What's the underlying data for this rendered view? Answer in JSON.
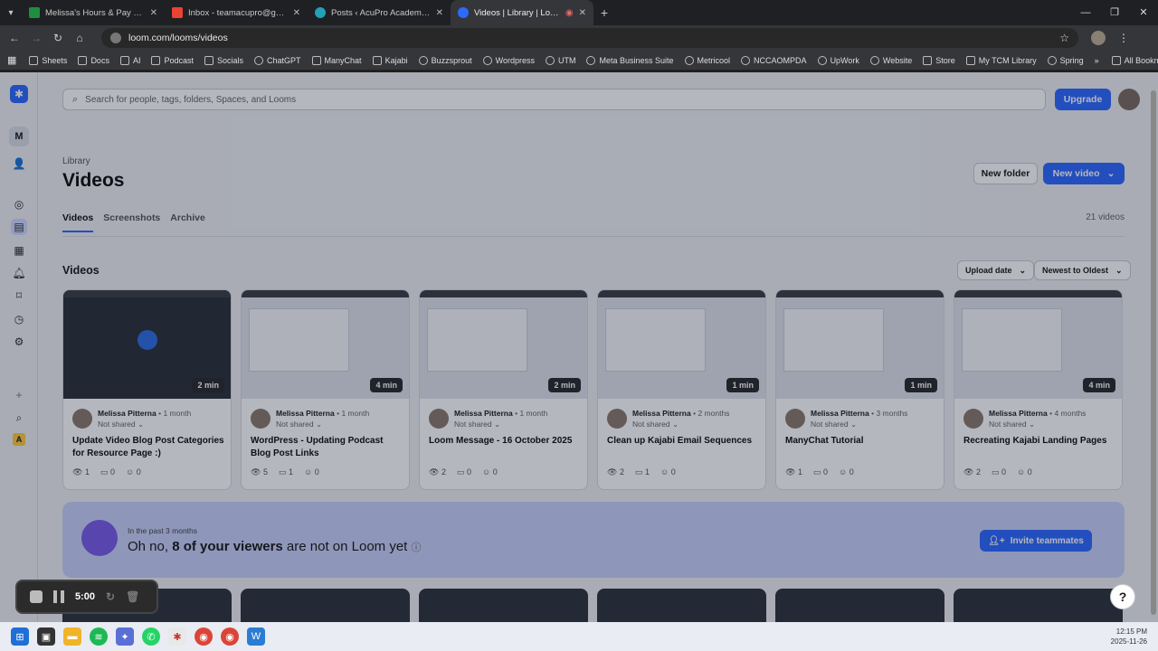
{
  "browser": {
    "tabs": [
      {
        "title": "Melissa's Hours & Pay - Google",
        "color": "#1e8e3e",
        "active": false
      },
      {
        "title": "Inbox - teamacupro@gmail.com",
        "color": "#ea4335",
        "active": false
      },
      {
        "title": "Posts ‹ AcuPro Academy | Acup",
        "color": "#21a0b8",
        "active": false
      },
      {
        "title": "Videos | Library | Loom",
        "color": "#2e69ff",
        "active": true
      }
    ],
    "url": "loom.com/looms/videos",
    "bookmarks": [
      "Sheets",
      "Docs",
      "AI",
      "Podcast",
      "Socials",
      "ChatGPT",
      "ManyChat",
      "Kajabi",
      "Buzzsprout",
      "Wordpress",
      "UTM",
      "Meta Business Suite",
      "Metricool",
      "NCCAOMPDA",
      "UpWork",
      "Website",
      "Store",
      "My TCM Library",
      "Spring"
    ],
    "all_bookmarks": "All Bookmarks"
  },
  "app": {
    "search_placeholder": "Search for people, tags, folders, Spaces, and Looms",
    "upgrade": "Upgrade",
    "workspace_initial": "M",
    "space_initial": "A",
    "breadcrumb": "Library",
    "title": "Videos",
    "new_folder": "New folder",
    "new_video": "New video",
    "tabs": [
      "Videos",
      "Screenshots",
      "Archive"
    ],
    "video_count": "21 videos",
    "section_title": "Videos",
    "sort_field": "Upload date",
    "sort_order": "Newest to Oldest",
    "help": "?"
  },
  "videos": [
    {
      "duration": "2 min",
      "author": "Melissa Pitterna",
      "ago": "1 month",
      "shared": "Not shared",
      "title": "Update Video Blog Post Categories for Resource Page :)",
      "views": "1",
      "comments": "0",
      "reactions": "0"
    },
    {
      "duration": "4 min",
      "author": "Melissa Pitterna",
      "ago": "1 month",
      "shared": "Not shared",
      "title": "WordPress - Updating Podcast Blog Post Links",
      "views": "5",
      "comments": "1",
      "reactions": "0"
    },
    {
      "duration": "2 min",
      "author": "Melissa Pitterna",
      "ago": "1 month",
      "shared": "Not shared",
      "title": "Loom Message - 16 October 2025",
      "views": "2",
      "comments": "0",
      "reactions": "0"
    },
    {
      "duration": "1 min",
      "author": "Melissa Pitterna",
      "ago": "2 months",
      "shared": "Not shared",
      "title": "Clean up Kajabi Email Sequences",
      "views": "2",
      "comments": "1",
      "reactions": "0"
    },
    {
      "duration": "1 min",
      "author": "Melissa Pitterna",
      "ago": "3 months",
      "shared": "Not shared",
      "title": "ManyChat Tutorial",
      "views": "1",
      "comments": "0",
      "reactions": "0"
    },
    {
      "duration": "4 min",
      "author": "Melissa Pitterna",
      "ago": "4 months",
      "shared": "Not shared",
      "title": "Recreating Kajabi Landing Pages",
      "views": "2",
      "comments": "0",
      "reactions": "0"
    }
  ],
  "banner": {
    "small": "In the past 3 months",
    "lead": "Oh no, ",
    "bold": "8 of your viewers",
    "tail": " are not on Loom yet",
    "invite": "Invite teammates"
  },
  "recorder": {
    "time": "5:00"
  },
  "taskbar": {
    "time": "12:15 PM",
    "date": "2025-11-26"
  }
}
